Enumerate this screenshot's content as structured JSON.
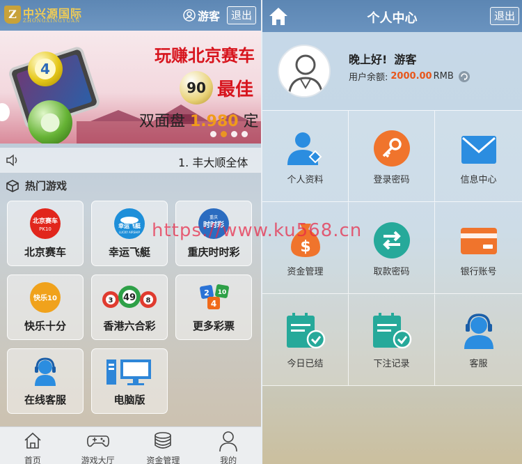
{
  "left": {
    "logo": {
      "name": "中兴源国际",
      "sub": "ZHONGXINGYUAN",
      "mark": "Z"
    },
    "header": {
      "user": "游客",
      "logout": "退出"
    },
    "banner": {
      "title": "玩赚北京赛车",
      "best": "最佳",
      "line_prefix": "双面盘 ",
      "line_number": "1.980",
      "line_suffix": " 定",
      "ball_a": "4",
      "ball_b": "90"
    },
    "marquee": {
      "text": "1. 丰大顺全体"
    },
    "section": {
      "title": "热门游戏"
    },
    "games": [
      {
        "label": "北京赛车",
        "icon": "bjpk10-icon"
      },
      {
        "label": "幸运飞艇",
        "icon": "lucky-airship-icon"
      },
      {
        "label": "重庆时时彩",
        "icon": "cqssc-icon"
      },
      {
        "label": "快乐十分",
        "icon": "happy-ten-icon"
      },
      {
        "label": "香港六合彩",
        "icon": "hk-mark-six-icon"
      },
      {
        "label": "更多彩票",
        "icon": "more-lottery-icon"
      },
      {
        "label": "在线客服",
        "icon": "online-service-icon"
      },
      {
        "label": "电脑版",
        "icon": "desktop-icon"
      }
    ],
    "game_badges": {
      "bj": "北京赛车",
      "bj_sub": "PK10",
      "xy": "幸运飞艇",
      "xy_sub": "LUCKY AIRSHIP",
      "cq": "时时彩",
      "cq_top": "重庆",
      "kl": "快乐10",
      "hk_nums": [
        "3",
        "49",
        "8"
      ],
      "more_nums": [
        "2",
        "4",
        "10"
      ]
    },
    "nav": [
      {
        "label": "首页",
        "icon": "home-icon"
      },
      {
        "label": "游戏大厅",
        "icon": "gamepad-icon"
      },
      {
        "label": "资金管理",
        "icon": "coins-icon"
      },
      {
        "label": "我的",
        "icon": "person-icon"
      }
    ]
  },
  "right": {
    "header": {
      "title": "个人中心",
      "logout": "退出"
    },
    "profile": {
      "greeting": "晚上好!",
      "user": "游客",
      "balance_label": "用户余额:",
      "balance": "2000.00",
      "currency": "RMB"
    },
    "menu": [
      {
        "label": "个人资料",
        "icon": "profile-icon"
      },
      {
        "label": "登录密码",
        "icon": "key-icon"
      },
      {
        "label": "信息中心",
        "icon": "mail-icon"
      },
      {
        "label": "资金管理",
        "icon": "money-bag-icon"
      },
      {
        "label": "取款密码",
        "icon": "exchange-icon"
      },
      {
        "label": "银行账号",
        "icon": "bank-card-icon"
      },
      {
        "label": "今日已结",
        "icon": "settled-today-icon"
      },
      {
        "label": "下注记录",
        "icon": "bet-record-icon"
      },
      {
        "label": "客服",
        "icon": "customer-service-icon"
      }
    ]
  },
  "watermark": "https://www.ku568.cn",
  "colors": {
    "header": "#6a93bf",
    "orange": "#f0742c",
    "teal": "#26a99a",
    "blue": "#2b8de0",
    "balance": "#e8561a",
    "banner_red": "#d7141d"
  }
}
